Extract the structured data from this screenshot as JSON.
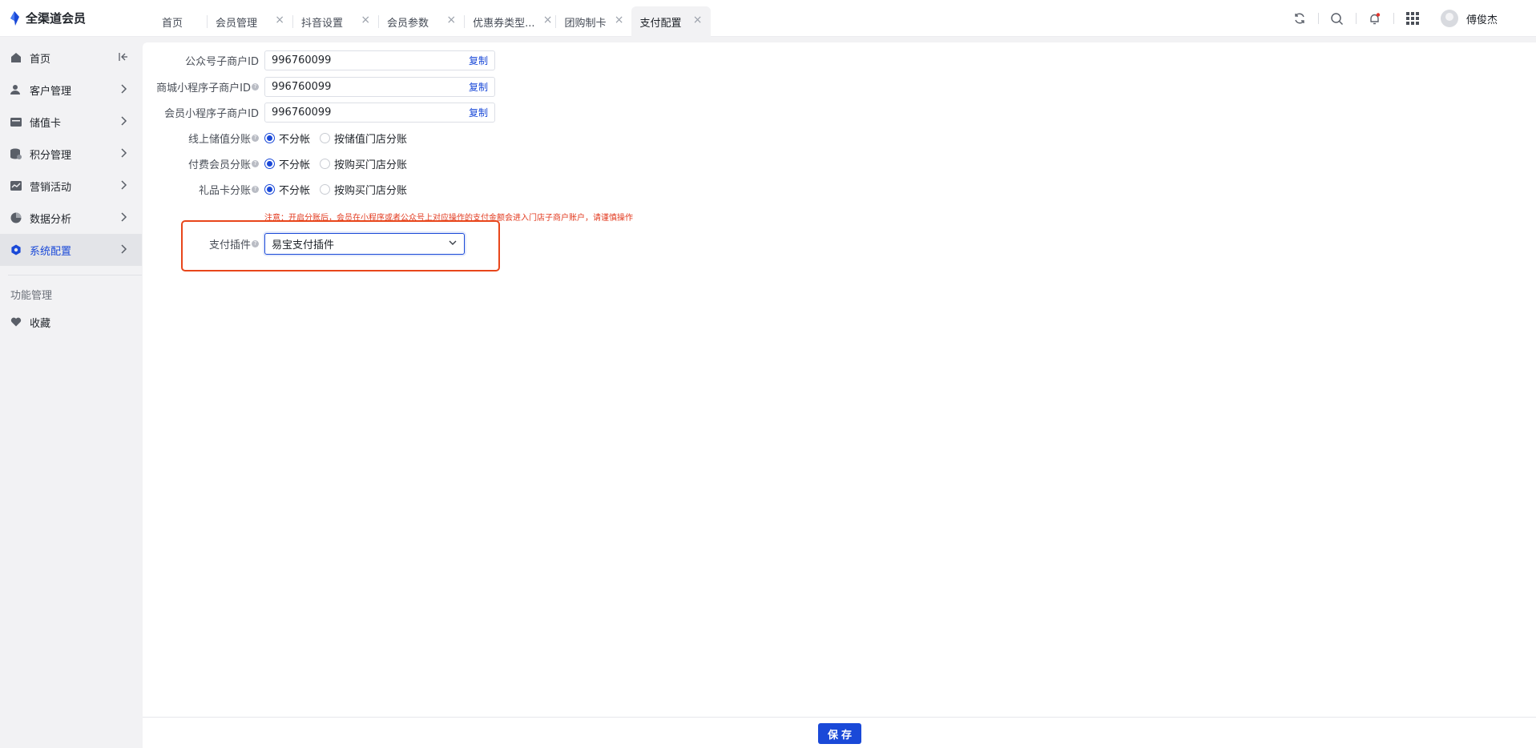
{
  "brand": {
    "name": "全渠道会员"
  },
  "tabs": [
    {
      "label": "首页",
      "closable": false,
      "active": false
    },
    {
      "label": "会员管理",
      "closable": true,
      "active": false
    },
    {
      "label": "抖音设置",
      "closable": true,
      "active": false
    },
    {
      "label": "会员参数",
      "closable": true,
      "active": false
    },
    {
      "label": "优惠券类型...",
      "closable": true,
      "active": false
    },
    {
      "label": "团购制卡",
      "closable": true,
      "active": false
    },
    {
      "label": "支付配置",
      "closable": true,
      "active": true
    }
  ],
  "tab_close_glyph": "×",
  "user": {
    "name": "傅俊杰"
  },
  "sidebar": {
    "items": [
      {
        "label": "首页",
        "icon": "home-icon"
      },
      {
        "label": "客户管理",
        "icon": "customer-icon"
      },
      {
        "label": "储值卡",
        "icon": "card-icon"
      },
      {
        "label": "积分管理",
        "icon": "points-icon"
      },
      {
        "label": "营销活动",
        "icon": "marketing-icon"
      },
      {
        "label": "数据分析",
        "icon": "analytics-icon"
      },
      {
        "label": "系统配置",
        "icon": "settings-icon",
        "active": true
      }
    ],
    "section_title": "功能管理",
    "favorites": {
      "label": "收藏",
      "icon": "heart-icon"
    }
  },
  "form": {
    "merchant_ids": [
      {
        "label": "公众号子商户ID",
        "has_help": false,
        "value": "996760099",
        "action": "复制"
      },
      {
        "label": "商城小程序子商户ID",
        "has_help": true,
        "value": "996760099",
        "action": "复制"
      },
      {
        "label": "会员小程序子商户ID",
        "has_help": false,
        "value": "996760099",
        "action": "复制"
      }
    ],
    "split_settings": [
      {
        "label": "线上储值分账",
        "options": [
          "不分帐",
          "按储值门店分账"
        ],
        "selected": 0
      },
      {
        "label": "付费会员分账",
        "options": [
          "不分帐",
          "按购买门店分账"
        ],
        "selected": 0
      },
      {
        "label": "礼品卡分账",
        "options": [
          "不分帐",
          "按购买门店分账"
        ],
        "selected": 0
      }
    ],
    "warning": "注意：开启分账后，会员在小程序或者公众号上对应操作的支付金额会进入门店子商户账户，请谨慎操作",
    "payment_plugin": {
      "label": "支付插件",
      "selected": "易宝支付插件"
    }
  },
  "footer": {
    "save_label": "保存"
  },
  "colors": {
    "primary": "#1a49d8",
    "warning": "#e23a1f",
    "highlight": "#e8461b"
  }
}
